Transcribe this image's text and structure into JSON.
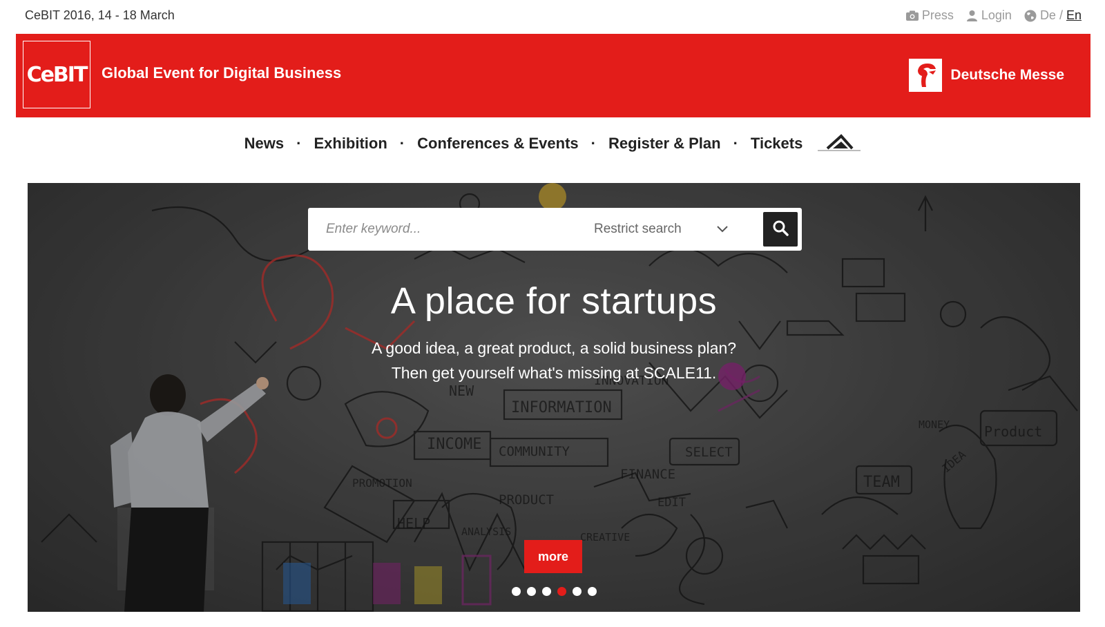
{
  "topbar": {
    "event_date": "CeBIT 2016, 14 - 18 March",
    "press_label": "Press",
    "login_label": "Login",
    "lang_de": "De",
    "lang_sep": "/",
    "lang_en": "En"
  },
  "brand": {
    "logo_text": "CeBIT",
    "tagline": "Global Event for Digital Business",
    "partner_name": "Deutsche Messe",
    "color": "#e31d1a"
  },
  "nav": {
    "items": [
      {
        "label": "News"
      },
      {
        "label": "Exhibition"
      },
      {
        "label": "Conferences & Events"
      },
      {
        "label": "Register & Plan"
      },
      {
        "label": "Tickets"
      }
    ],
    "separator": "·",
    "home_icon": "home-icon"
  },
  "hero": {
    "search_placeholder": "Enter keyword...",
    "restrict_label": "Restrict search",
    "title": "A place for startups",
    "subtitle_line1": "A good idea, a great product, a solid business plan?",
    "subtitle_line2": "Then get yourself what's missing at SCALE11.",
    "more_label": "more",
    "slides_total": 6,
    "slide_active": 4,
    "wall_words": [
      "INFORMATION",
      "INNOVATION",
      "INCOME",
      "COMMUNITY",
      "SELECT",
      "FINANCE",
      "PRODUCT",
      "TEAM",
      "MONEY",
      "Product",
      "IDEA",
      "HELP",
      "NEW",
      "PROMOTION",
      "ANALYSIS",
      "CREATIVE",
      "EDIT"
    ]
  }
}
